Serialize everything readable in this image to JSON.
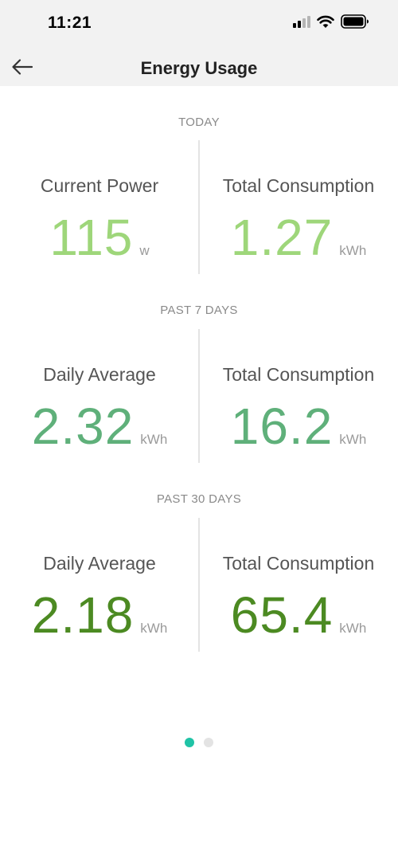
{
  "status_bar": {
    "time": "11:21"
  },
  "header": {
    "title": "Energy Usage"
  },
  "sections": [
    {
      "label": "TODAY",
      "left": {
        "title": "Current Power",
        "value": "115",
        "unit": "w"
      },
      "right": {
        "title": "Total Consumption",
        "value": "1.27",
        "unit": "kWh"
      }
    },
    {
      "label": "PAST 7 DAYS",
      "left": {
        "title": "Daily Average",
        "value": "2.32",
        "unit": "kWh"
      },
      "right": {
        "title": "Total Consumption",
        "value": "16.2",
        "unit": "kWh"
      }
    },
    {
      "label": "PAST 30 DAYS",
      "left": {
        "title": "Daily Average",
        "value": "2.18",
        "unit": "kWh"
      },
      "right": {
        "title": "Total Consumption",
        "value": "65.4",
        "unit": "kWh"
      }
    }
  ],
  "colors": {
    "today_value": "#9ed67a",
    "past7_value": "#5fb07a",
    "past30_value": "#4c8a22",
    "active_dot": "#20c3a6",
    "inactive_dot": "#e3e3e3"
  },
  "pagination": {
    "current_page": 1,
    "total_pages": 2
  },
  "icons": {
    "back": "arrow-left-icon",
    "signal": "cellular-signal-icon",
    "wifi": "wifi-icon",
    "battery": "battery-icon"
  }
}
